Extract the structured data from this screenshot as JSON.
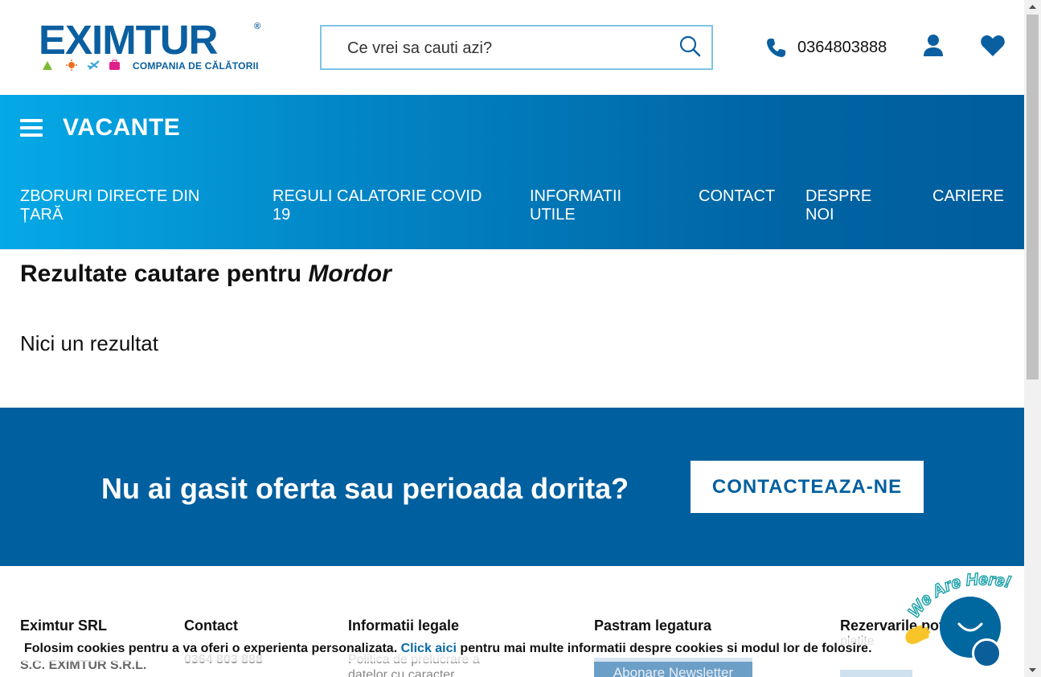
{
  "header": {
    "logo_text": "EXIMTUR",
    "logo_reg": "®",
    "logo_tagline": "COMPANIA DE CĂLĂTORII",
    "search_placeholder": "Ce vrei sa cauti azi?",
    "phone": "0364803888"
  },
  "nav": {
    "menu_label": "VACANTE",
    "links": [
      "ZBORURI DIRECTE DIN ȚARĂ",
      "REGULI CALATORIE COVID 19",
      "INFORMATII UTILE",
      "CONTACT",
      "DESPRE NOI",
      "CARIERE"
    ]
  },
  "results": {
    "title_prefix": "Rezultate cautare pentru",
    "query": "Mordor",
    "empty_message": "Nici un rezultat"
  },
  "cta": {
    "text": "Nu ai gasit oferta sau perioada dorita?",
    "button": "CONTACTEAZA-NE"
  },
  "footer": {
    "col1_title": "Eximtur SRL",
    "col1_line": "S.C. EXIMTUR S.R.L.",
    "col2_title": "Contact",
    "col2_line": "0364 803 888",
    "col3_title": "Informatii legale",
    "col3_line1": "Politica de prelucrare a",
    "col3_line2": "datelor cu caracter",
    "col4_title": "Pastram legatura",
    "newsletter_button": "Abonare Newsletter",
    "col5_title": "Rezervarile pot fi",
    "col5_line": "platite"
  },
  "cookie": {
    "text_before": "Folosim cookies pentru a va oferi o experienta personalizata.",
    "link": "Click aici",
    "text_after": "pentru mai multe informatii despre cookies si modul lor de folosire."
  },
  "chat": {
    "label": "We Are Here!"
  },
  "colors": {
    "brand": "#0a5fa0",
    "nav_gradient_start": "#05a9e6",
    "nav_gradient_end": "#005d9d",
    "cta_bg": "#005f9e"
  }
}
